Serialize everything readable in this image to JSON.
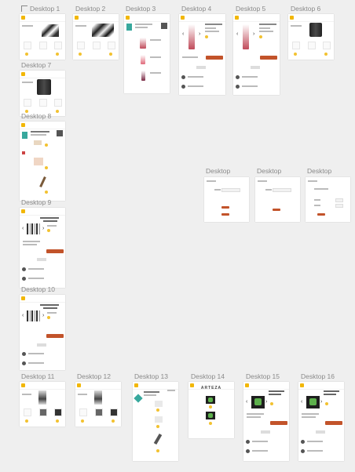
{
  "frames": {
    "d1": "Desktop 1",
    "d2": "Desktop 2",
    "d3": "Desktop 3",
    "d4": "Desktop 4",
    "d5": "Desktop 5",
    "d6": "Desktop 6",
    "d7": "Desktop 7",
    "d8": "Desktop 8",
    "d9": "Desktop 9",
    "d10": "Desktop 10",
    "d11": "Desktop 11",
    "d12": "Desktop 12",
    "d13": "Desktop 13",
    "d14": "Desktop 14",
    "d15": "Desktop 15",
    "d16": "Desktop 16",
    "dA": "Desktop",
    "dB": "Desktop",
    "dC": "Desktop"
  },
  "brand": {
    "accent": "#c2532a",
    "logo": "#f2b705",
    "canvas": "#efefef"
  }
}
